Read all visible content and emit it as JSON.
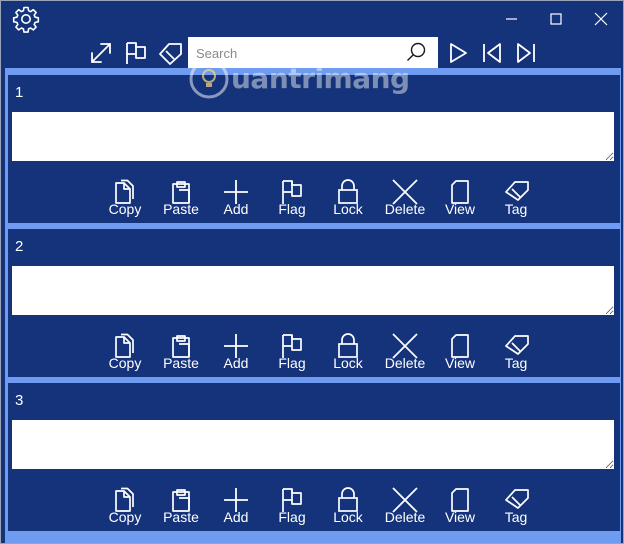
{
  "window": {
    "controls": {
      "minimize": "minimize",
      "maximize": "maximize",
      "close": "close"
    }
  },
  "toolbar": {
    "icons": [
      "settings-gear-icon",
      "expand-icon",
      "flag-icon",
      "tag-icon",
      "play-icon",
      "skip-previous-icon",
      "skip-next-icon"
    ]
  },
  "search": {
    "placeholder": "Search",
    "value": ""
  },
  "watermark": {
    "text": "uantrimang"
  },
  "colors": {
    "background": "#14337a",
    "item_separator": "#6f9bf0",
    "text": "#ffffff"
  },
  "items": [
    {
      "number": "1",
      "content": ""
    },
    {
      "number": "2",
      "content": ""
    },
    {
      "number": "3",
      "content": ""
    }
  ],
  "actions": {
    "copy": "Copy",
    "paste": "Paste",
    "add": "Add",
    "flag": "Flag",
    "lock": "Lock",
    "delete": "Delete",
    "view": "View",
    "tag": "Tag"
  }
}
